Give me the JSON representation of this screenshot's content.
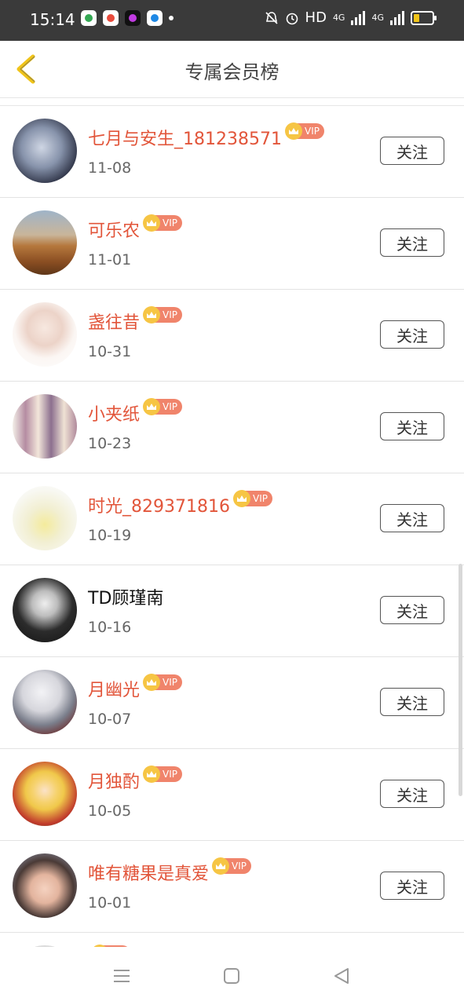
{
  "status": {
    "time": "15:14",
    "hd": "HD",
    "net1": "4G",
    "net2": "4G"
  },
  "header": {
    "title": "专属会员榜"
  },
  "vip_label": "VIP",
  "follow_label": "关注",
  "rows": [
    {
      "name": "七月与安生_181238571",
      "vip": true,
      "date": "11-08"
    },
    {
      "name": "可乐农",
      "vip": true,
      "date": "11-01"
    },
    {
      "name": "盏往昔",
      "vip": true,
      "date": "10-31"
    },
    {
      "name": "小夹纸",
      "vip": true,
      "date": "10-23"
    },
    {
      "name": "时光_829371816",
      "vip": true,
      "date": "10-19"
    },
    {
      "name": "TD顾瑾南",
      "vip": false,
      "date": "10-16"
    },
    {
      "name": "月幽光",
      "vip": true,
      "date": "10-07"
    },
    {
      "name": "月独酌",
      "vip": true,
      "date": "10-05"
    },
    {
      "name": "唯有糖果是真爱",
      "vip": true,
      "date": "10-01"
    },
    {
      "name": "",
      "vip": true,
      "date": ""
    }
  ],
  "colors": {
    "accent_name": "#e2553a",
    "vip_badge": "#f0846b",
    "crown": "#f6c544",
    "back_arrow": "#f0c419"
  }
}
